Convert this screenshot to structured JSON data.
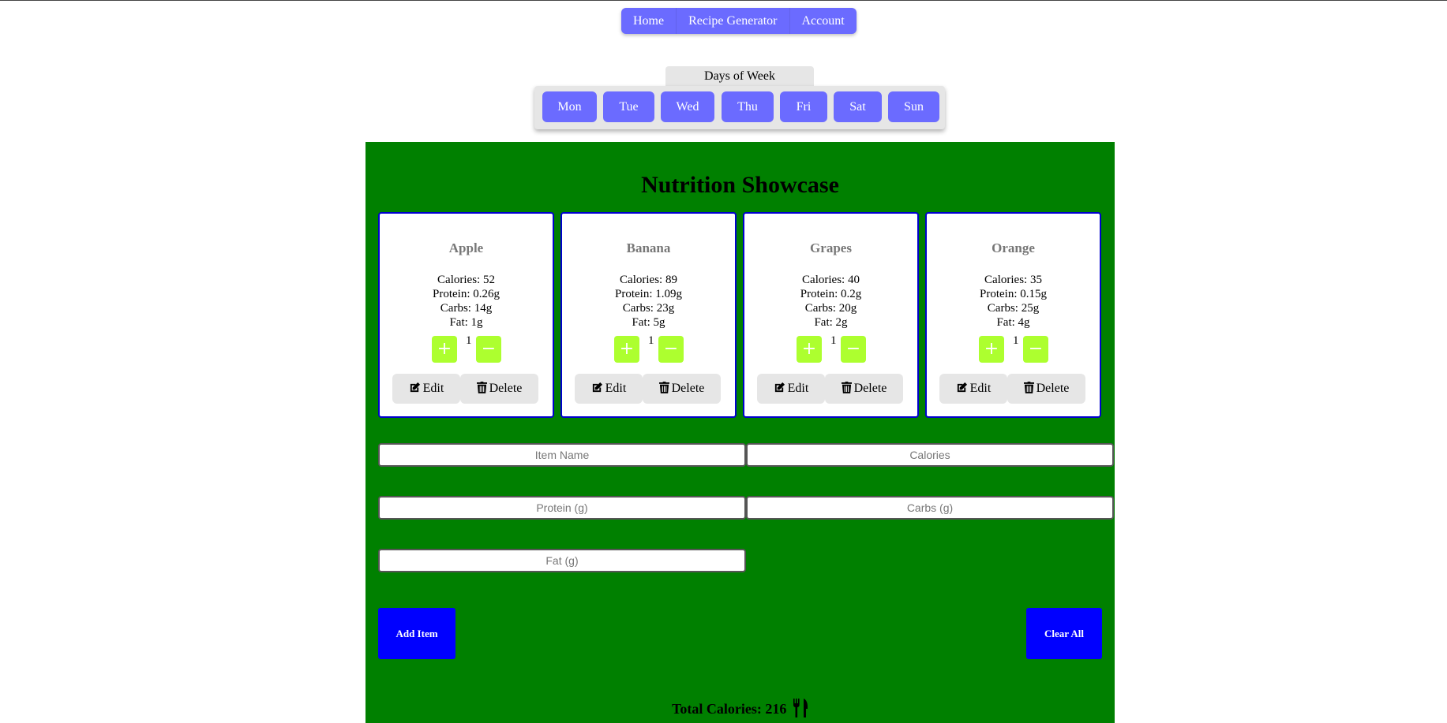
{
  "nav": {
    "items": [
      {
        "label": "Home"
      },
      {
        "label": "Recipe Generator"
      },
      {
        "label": "Account"
      }
    ]
  },
  "days": {
    "title": "Days of Week",
    "items": [
      "Mon",
      "Tue",
      "Wed",
      "Thu",
      "Fri",
      "Sat",
      "Sun"
    ]
  },
  "showcase": {
    "title": "Nutrition Showcase",
    "cards": [
      {
        "name": "Apple",
        "calories": "Calories: 52",
        "protein": "Protein: 0.26g",
        "carbs": "Carbs: 14g",
        "fat": "Fat: 1g",
        "qty": "1",
        "edit": "Edit",
        "delete": "Delete"
      },
      {
        "name": "Banana",
        "calories": "Calories: 89",
        "protein": "Protein: 1.09g",
        "carbs": "Carbs: 23g",
        "fat": "Fat: 5g",
        "qty": "1",
        "edit": "Edit",
        "delete": "Delete"
      },
      {
        "name": "Grapes",
        "calories": "Calories: 40",
        "protein": "Protein: 0.2g",
        "carbs": "Carbs: 20g",
        "fat": "Fat: 2g",
        "qty": "1",
        "edit": "Edit",
        "delete": "Delete"
      },
      {
        "name": "Orange",
        "calories": "Calories: 35",
        "protein": "Protein: 0.15g",
        "carbs": "Carbs: 25g",
        "fat": "Fat: 4g",
        "qty": "1",
        "edit": "Edit",
        "delete": "Delete"
      }
    ],
    "plus_symbol": "+",
    "minus_symbol": "−"
  },
  "form": {
    "item_name_placeholder": "Item Name",
    "calories_placeholder": "Calories",
    "protein_placeholder": "Protein (g)",
    "carbs_placeholder": "Carbs (g)",
    "fat_placeholder": "Fat (g)",
    "add_label": "Add Item",
    "clear_label": "Clear All"
  },
  "total": {
    "label": "Total Calories: 216"
  },
  "icons": {
    "edit": "edit-icon",
    "delete": "trash-icon",
    "total": "utensils-icon"
  },
  "colors": {
    "nav": "#6b6bff",
    "main_bg": "#008000",
    "card_border": "#0000cc",
    "qty_button": "#adff2f",
    "action_button": "#0000ff"
  }
}
